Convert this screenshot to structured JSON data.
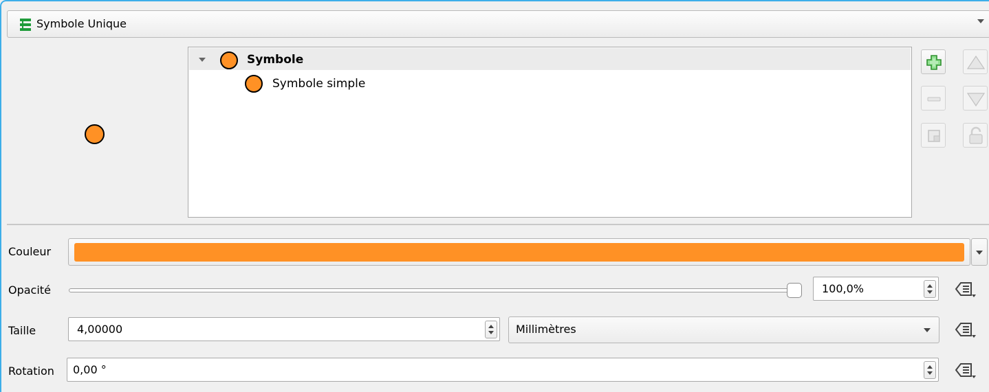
{
  "renderer": {
    "label": "Symbole Unique",
    "icon": "single-symbol-renderer-icon"
  },
  "tree": {
    "items": [
      {
        "label": "Symbole",
        "icon": "orange-circle-marker-icon",
        "expanded": true,
        "selected": true
      },
      {
        "label": "Symbole simple",
        "icon": "orange-circle-marker-icon"
      }
    ]
  },
  "tool_buttons": {
    "add": "plus-icon",
    "remove": "minus-icon",
    "duplicate": "duplicate-icon",
    "move_up": "triangle-up-icon",
    "move_down": "triangle-down-icon",
    "lock": "unlock-icon"
  },
  "properties": {
    "color": {
      "label": "Couleur",
      "value": "#ff9125"
    },
    "opacity": {
      "label": "Opacité",
      "value": "100,0%",
      "fraction": 1.0
    },
    "size": {
      "label": "Taille",
      "value": "4,00000",
      "unit": "Millimètres"
    },
    "rotation": {
      "label": "Rotation",
      "value": "0,00 °"
    }
  },
  "colors": {
    "symbol_fill": "#ff9125",
    "focus": "#3daee9",
    "add_green": "#3aa33a"
  }
}
